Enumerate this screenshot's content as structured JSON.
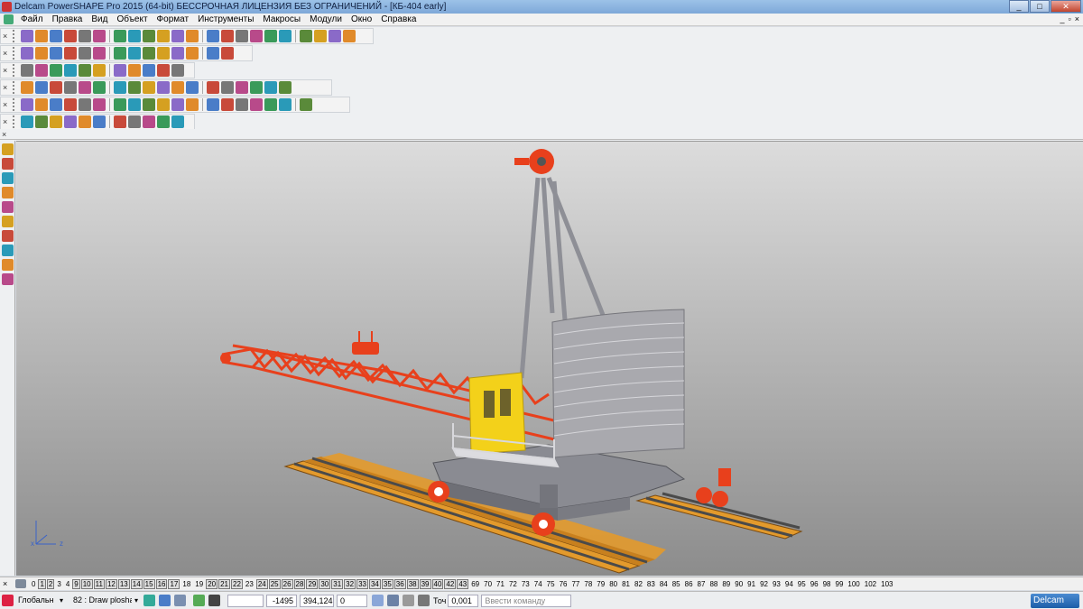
{
  "window": {
    "title": "Delcam PowerSHAPE Pro 2015 (64-bit) БЕССРОЧНАЯ ЛИЦЕНЗИЯ БЕЗ ОГРАНИЧЕНИЙ - [КБ-404 early]",
    "controls": [
      "_",
      "□",
      "✕"
    ]
  },
  "menu": {
    "items": [
      "Файл",
      "Правка",
      "Вид",
      "Объект",
      "Формат",
      "Инструменты",
      "Макросы",
      "Модули",
      "Окно",
      "Справка"
    ],
    "doc_controls": [
      "_",
      "▫",
      "×"
    ]
  },
  "levels": {
    "items": [
      "0",
      "1",
      "2",
      "3",
      "4",
      "9",
      "10",
      "11",
      "12",
      "13",
      "14",
      "15",
      "16",
      "17",
      "18",
      "19",
      "20",
      "21",
      "22",
      "23",
      "24",
      "25",
      "26",
      "28",
      "29",
      "30",
      "31",
      "32",
      "33",
      "34",
      "35",
      "36",
      "38",
      "39",
      "40",
      "42",
      "43",
      "69",
      "70",
      "71",
      "72",
      "73",
      "74",
      "75",
      "76",
      "77",
      "78",
      "79",
      "80",
      "81",
      "82",
      "83",
      "84",
      "85",
      "86",
      "87",
      "88",
      "89",
      "90",
      "91",
      "92",
      "93",
      "94",
      "95",
      "96",
      "98",
      "99",
      "100",
      "102",
      "103"
    ],
    "active": [
      "1",
      "2",
      "9",
      "10",
      "11",
      "12",
      "13",
      "14",
      "15",
      "16",
      "17",
      "20",
      "21",
      "22",
      "24",
      "25",
      "26",
      "28",
      "29",
      "30",
      "31",
      "32",
      "33",
      "34",
      "35",
      "36",
      "38",
      "39",
      "40",
      "42",
      "43"
    ]
  },
  "status": {
    "workplane": "Глобальн",
    "workplane_arrow": "▾",
    "level": "82 : Draw plosha",
    "level_arrow": "▾",
    "x": "-1495",
    "y": "394,124",
    "z": "0",
    "tol_label": "Точ",
    "tolerance": "0,001",
    "command_placeholder": "Ввести команду",
    "brand": "Delcam"
  },
  "colors": {
    "crane_red": "#e8401c",
    "counterweight": "#a9a9ae",
    "cabin": "#f3d11a",
    "rail": "#e39a2c",
    "frame": "#8a8b92"
  }
}
